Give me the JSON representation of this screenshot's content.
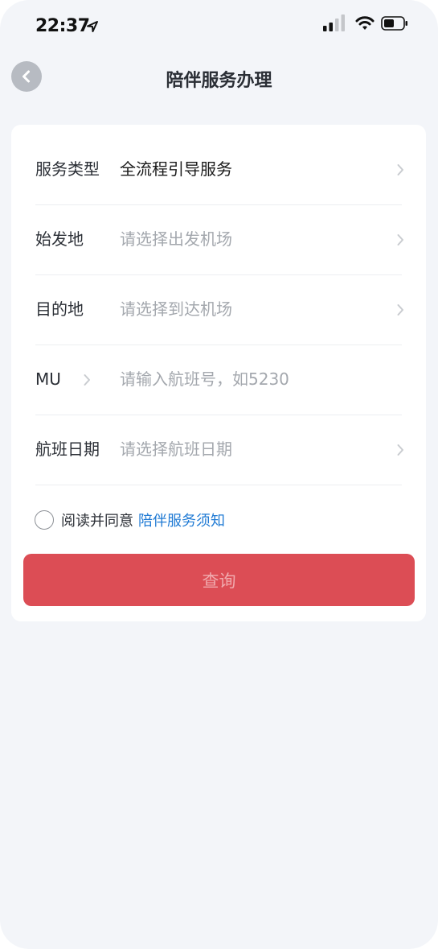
{
  "status_bar": {
    "time": "22:37"
  },
  "header": {
    "title": "陪伴服务办理"
  },
  "form": {
    "service_type": {
      "label": "服务类型",
      "value": "全流程引导服务"
    },
    "origin": {
      "label": "始发地",
      "placeholder": "请选择出发机场"
    },
    "destination": {
      "label": "目的地",
      "placeholder": "请选择到达机场"
    },
    "flight_no": {
      "label": "MU",
      "placeholder": "请输入航班号，如5230"
    },
    "flight_date": {
      "label": "航班日期",
      "placeholder": "请选择航班日期"
    }
  },
  "agreement": {
    "text": "阅读并同意",
    "link": "陪伴服务须知"
  },
  "submit_label": "查询",
  "colors": {
    "background": "#f3f5f9",
    "primary_button": "#dc4d55",
    "link": "#1f7ad4",
    "placeholder": "#a4a8ae"
  }
}
